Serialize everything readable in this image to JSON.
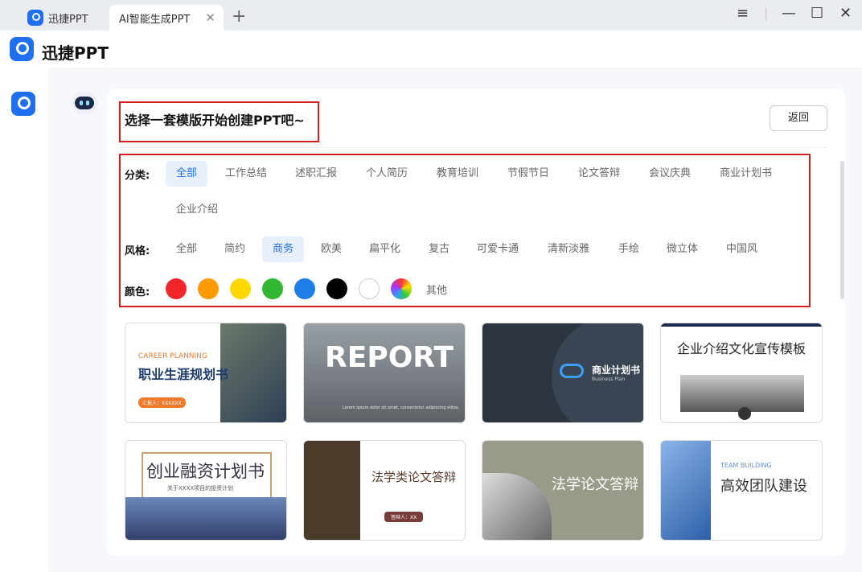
{
  "tabs": [
    {
      "label": "迅捷PPT"
    },
    {
      "label": "AI智能生成PPT"
    }
  ],
  "window": {
    "menu_icon": "≡",
    "minimize_icon": "—",
    "maximize_icon": "☐",
    "close_icon": "✕"
  },
  "brand": {
    "name": "迅捷PPT"
  },
  "header": {
    "title": "选择一套模版开始创建PPT吧~",
    "back_label": "返回"
  },
  "filters": {
    "category_label": "分类:",
    "categories": [
      "全部",
      "工作总结",
      "述职汇报",
      "个人简历",
      "教育培训",
      "节假节日",
      "论文答辩",
      "会议庆典",
      "商业计划书",
      "企业介绍"
    ],
    "style_label": "风格:",
    "styles": [
      "全部",
      "简约",
      "商务",
      "欧美",
      "扁平化",
      "复古",
      "可爱卡通",
      "清新淡雅",
      "手绘",
      "微立体",
      "中国风"
    ],
    "color_label": "颜色:",
    "colors": [
      "#f2262a",
      "#ff9a00",
      "#ffd800",
      "#33b733",
      "#1f7de8",
      "#000000",
      "#ffffff"
    ],
    "other_label": "其他",
    "active_category": "全部",
    "active_style": "商务"
  },
  "templates": [
    {
      "texts": [
        "CAREER PLANNING",
        "职业生涯规划书",
        "汇报人：XXXXXX"
      ]
    },
    {
      "texts": [
        "REPORT",
        "Lorem ipsum dolor sit amet, consectetur adipiscing elites."
      ]
    },
    {
      "texts": [
        "商业计划书",
        "Business Plan"
      ]
    },
    {
      "texts": [
        "企业介绍文化宣传模板"
      ]
    },
    {
      "texts": [
        "创业融资计划书",
        "关于XXXX项目的投资计划"
      ]
    },
    {
      "texts": [
        "法学类论文答辩",
        "答辩人：XX"
      ]
    },
    {
      "texts": [
        "法学论文答辩"
      ]
    },
    {
      "texts": [
        "TEAM BUILDING",
        "高效团队建设"
      ]
    }
  ]
}
